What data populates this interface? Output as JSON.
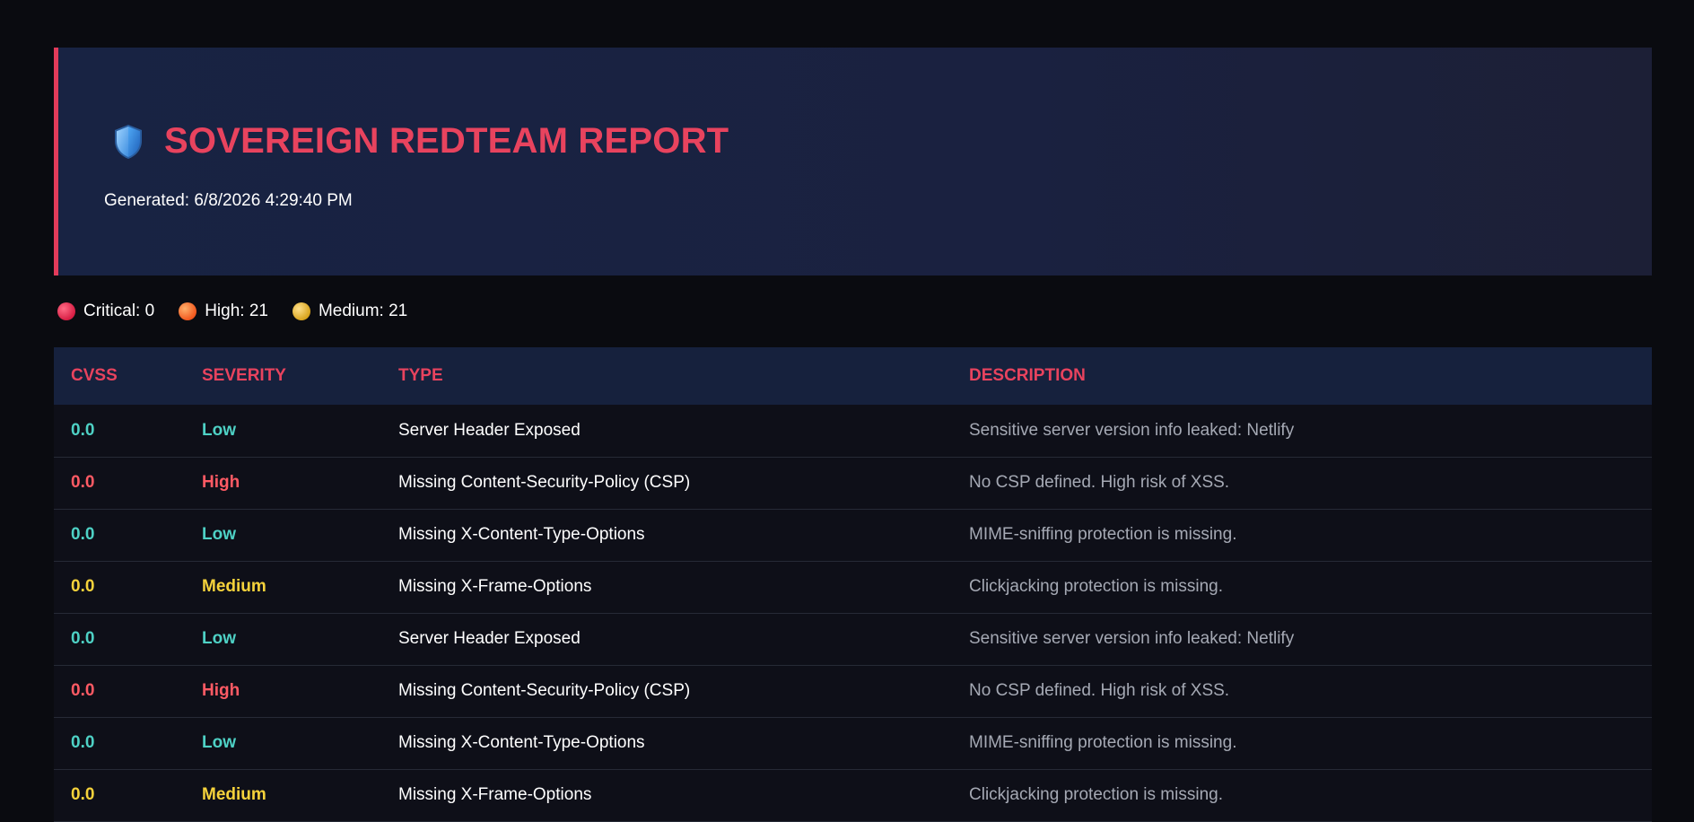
{
  "header": {
    "title": "SOVEREIGN REDTEAM REPORT",
    "generated": "Generated: 6/8/2026 4:29:40 PM",
    "icon": "shield-icon"
  },
  "stats": [
    {
      "label": "Critical: 0",
      "severity": "critical",
      "color": "#e23b5a"
    },
    {
      "label": "High: 21",
      "severity": "high",
      "color": "#f2681e"
    },
    {
      "label": "Medium: 21",
      "severity": "medium",
      "color": "#e2b22a"
    }
  ],
  "table": {
    "headers": [
      "CVSS",
      "SEVERITY",
      "TYPE",
      "DESCRIPTION"
    ],
    "rows": [
      {
        "cvss": "0.0",
        "severity": "Low",
        "type": "Server Header Exposed",
        "description": "Sensitive server version info leaked: Netlify"
      },
      {
        "cvss": "0.0",
        "severity": "High",
        "type": "Missing Content-Security-Policy (CSP)",
        "description": "No CSP defined. High risk of XSS."
      },
      {
        "cvss": "0.0",
        "severity": "Low",
        "type": "Missing X-Content-Type-Options",
        "description": "MIME-sniffing protection is missing."
      },
      {
        "cvss": "0.0",
        "severity": "Medium",
        "type": "Missing X-Frame-Options",
        "description": "Clickjacking protection is missing."
      },
      {
        "cvss": "0.0",
        "severity": "Low",
        "type": "Server Header Exposed",
        "description": "Sensitive server version info leaked: Netlify"
      },
      {
        "cvss": "0.0",
        "severity": "High",
        "type": "Missing Content-Security-Policy (CSP)",
        "description": "No CSP defined. High risk of XSS."
      },
      {
        "cvss": "0.0",
        "severity": "Low",
        "type": "Missing X-Content-Type-Options",
        "description": "MIME-sniffing protection is missing."
      },
      {
        "cvss": "0.0",
        "severity": "Medium",
        "type": "Missing X-Frame-Options",
        "description": "Clickjacking protection is missing."
      }
    ]
  },
  "colors": {
    "accent": "#e8435e",
    "low": "#4ed1c5",
    "high": "#ff5a64",
    "medium": "#f5d23b"
  }
}
